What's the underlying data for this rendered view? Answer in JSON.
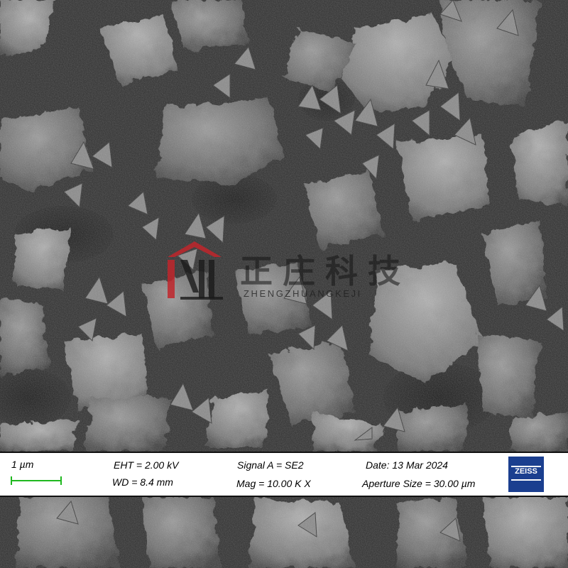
{
  "image": {
    "subject": "SEM micrograph of flaky particle aggregates",
    "background_color": "#3a3a3a"
  },
  "watermark": {
    "chinese_text": "正庄科技",
    "latin_text": "ZHENGZHUANGKEJI",
    "accent_color": "#c0262b"
  },
  "databar": {
    "scale_label": "1 µm",
    "scale_color": "#1fb81f",
    "eht": "EHT =  2.00 kV",
    "wd": "WD =  8.4 mm",
    "signal": "Signal A = SE2",
    "mag": "Mag =    10.00 K X",
    "date": "Date: 13 Mar 2024",
    "aperture": "Aperture Size = 30.00 µm",
    "logo_text": "ZEISS",
    "logo_color": "#1b3f8f"
  }
}
